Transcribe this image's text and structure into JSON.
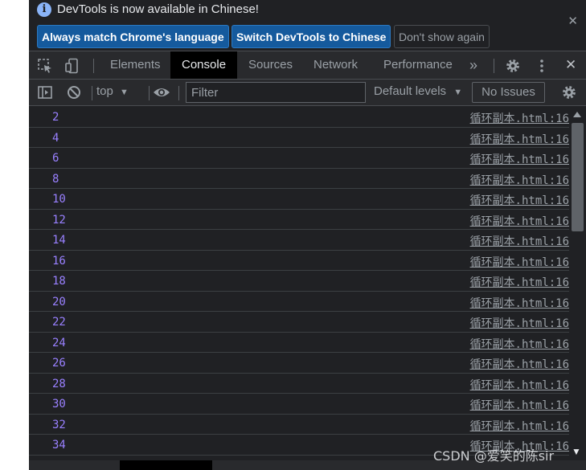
{
  "infobar": {
    "message": "DevTools is now available in Chinese!",
    "buttons": {
      "match_language": "Always match Chrome's language",
      "switch_chinese": "Switch DevTools to Chinese",
      "dont_show": "Don't show again"
    },
    "close_glyph": "✕"
  },
  "tabs": [
    "Elements",
    "Console",
    "Sources",
    "Network",
    "Performance"
  ],
  "active_tab": "Console",
  "tabbar": {
    "more_glyph": "»",
    "close_glyph": "✕"
  },
  "toolbar": {
    "context": "top",
    "filter_placeholder": "Filter",
    "levels": "Default levels",
    "issues": "No Issues"
  },
  "console": {
    "values": [
      "2",
      "4",
      "6",
      "8",
      "10",
      "12",
      "14",
      "16",
      "18",
      "20",
      "22",
      "24",
      "26",
      "28",
      "30",
      "32",
      "34"
    ],
    "source": "循环副本.html:16"
  },
  "watermark": "CSDN @爱笑的陈sir",
  "colors": {
    "panel_bg": "#202124",
    "toolbar_bg": "#292a2d",
    "number": "#9980ff",
    "primary_button": "#155a9d"
  }
}
